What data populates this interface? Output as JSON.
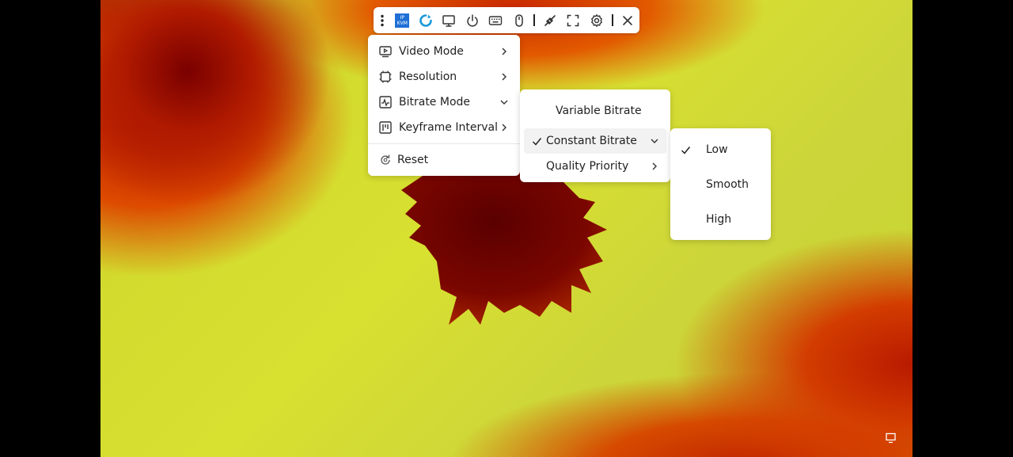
{
  "toolbar": {
    "kvm_badge_top": "IP",
    "kvm_badge_bottom": "KVM",
    "icons": [
      "more-vertical-icon",
      "ip-kvm-logo",
      "refresh-icon",
      "monitor-icon",
      "power-icon",
      "keyboard-icon",
      "mouse-icon",
      "cable-icon",
      "fullscreen-icon",
      "settings-icon",
      "close-icon"
    ]
  },
  "main_menu": {
    "items": [
      {
        "label": "Video Mode",
        "icon": "video-icon"
      },
      {
        "label": "Resolution",
        "icon": "resolution-icon"
      },
      {
        "label": "Bitrate Mode",
        "icon": "bitrate-icon"
      },
      {
        "label": "Keyframe Interval",
        "icon": "keyframe-icon"
      }
    ],
    "reset_label": "Reset"
  },
  "bitrate_menu": {
    "items": [
      {
        "label": "Variable Bitrate",
        "checked": false
      },
      {
        "label": "Constant Bitrate",
        "checked": true
      },
      {
        "label": "Quality Priority",
        "checked": false
      }
    ]
  },
  "constant_menu": {
    "items": [
      {
        "label": "Low",
        "checked": true
      },
      {
        "label": "Smooth",
        "checked": false
      },
      {
        "label": "High",
        "checked": false
      }
    ]
  },
  "colors": {
    "accent": "#1f6fd6",
    "refresh": "#1a9ad8",
    "menu_bg": "#ffffff",
    "active_bg": "#f2f2f2"
  }
}
